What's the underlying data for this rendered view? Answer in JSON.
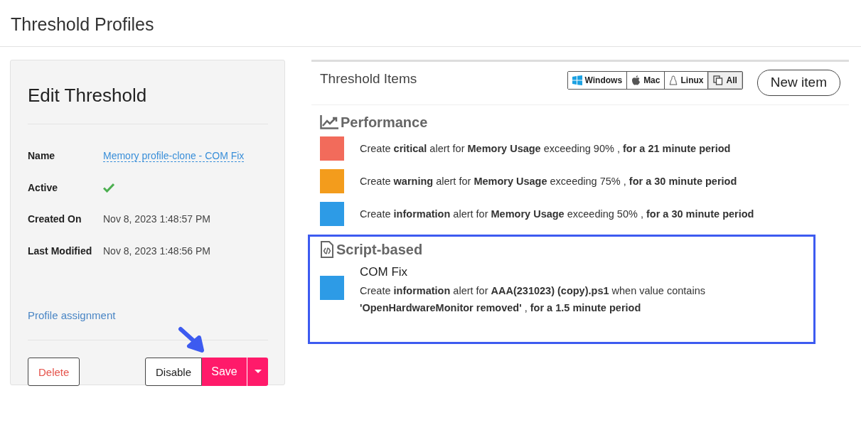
{
  "page_title": "Threshold Profiles",
  "edit_panel": {
    "title": "Edit Threshold",
    "fields": [
      {
        "kind": "link",
        "label": "Name",
        "value": "Memory profile-clone - COM Fix"
      },
      {
        "kind": "check",
        "label": "Active",
        "checked": true
      },
      {
        "kind": "text",
        "label": "Created On",
        "value": "Nov 8, 2023 1:48:57 PM"
      },
      {
        "kind": "text",
        "label": "Last Modified",
        "value": "Nov 8, 2023 1:48:56 PM"
      }
    ],
    "profile_link": "Profile assignment",
    "buttons": {
      "delete": "Delete",
      "disable": "Disable",
      "save": "Save"
    }
  },
  "items_panel": {
    "title": "Threshold Items",
    "os_filters": [
      {
        "kind": "windows",
        "label": "Windows",
        "selected": false
      },
      {
        "kind": "mac",
        "label": "Mac",
        "selected": false
      },
      {
        "kind": "linux",
        "label": "Linux",
        "selected": false
      },
      {
        "kind": "all",
        "label": "All",
        "selected": true
      }
    ],
    "new_button": "New item",
    "sections": [
      {
        "kind": "performance",
        "title": "Performance",
        "highlighted": false,
        "items": [
          {
            "color": "#f26b5b",
            "text": "Create **critical** alert for **Memory Usage** exceeding 90% , **for a 21 minute period**"
          },
          {
            "color": "#f39c1c",
            "text": "Create **warning** alert for **Memory Usage** exceeding 75% , **for a 30 minute period**"
          },
          {
            "color": "#2d9be6",
            "text": "Create **information** alert for **Memory Usage** exceeding 50% , **for a 30 minute period**"
          }
        ]
      },
      {
        "kind": "script",
        "title": "Script-based",
        "highlighted": true,
        "items": [
          {
            "color": "#2d9be6",
            "name": "COM Fix",
            "text": "Create **information** alert for **AAA(231023) (copy).ps1** when value contains **'OpenHardwareMonitor removed'** , **for a 1.5 minute period**"
          }
        ]
      }
    ]
  }
}
